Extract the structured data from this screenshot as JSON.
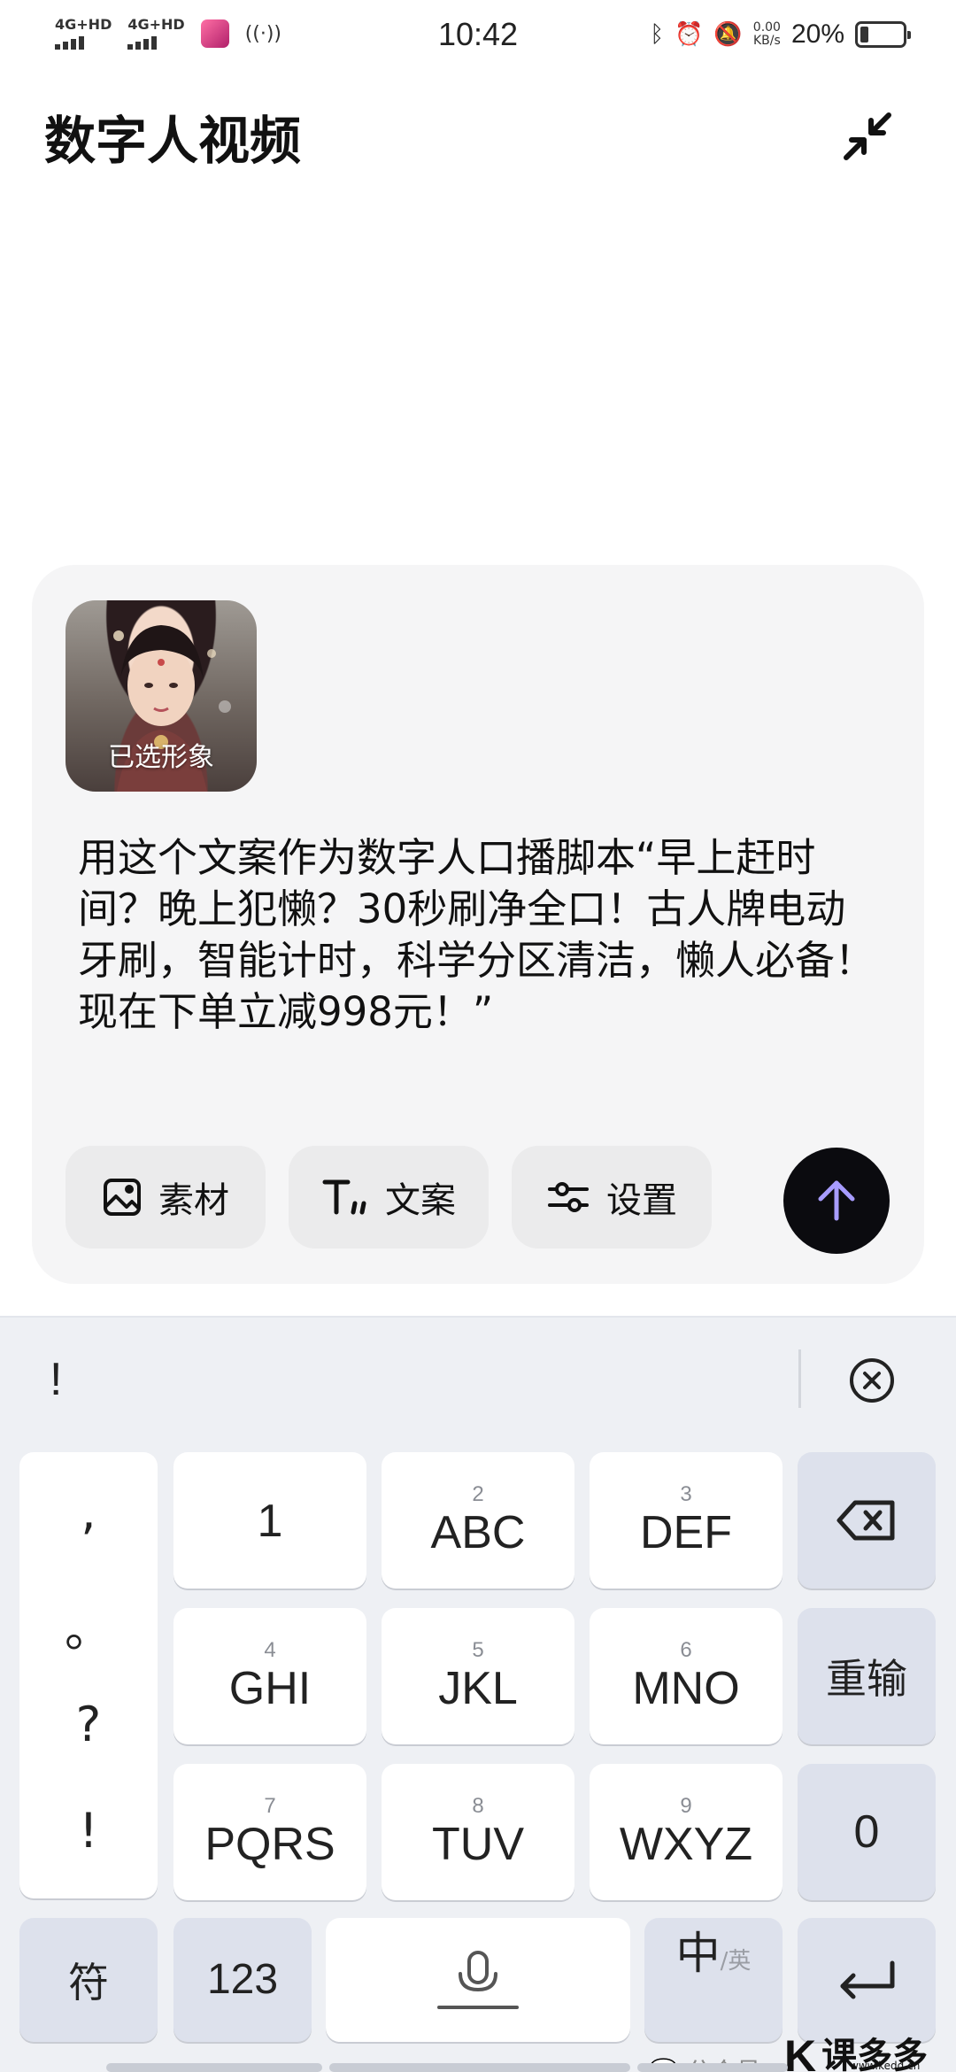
{
  "status_bar": {
    "signal_1": "4G+HD",
    "signal_2": "4G+HD",
    "time": "10:42",
    "net_speed_value": "0.00",
    "net_speed_unit": "KB/s",
    "battery_percent": "20%",
    "battery_level": 0.2
  },
  "header": {
    "title": "数字人视频"
  },
  "composer": {
    "avatar_label": "已选形象",
    "prompt": "用这个文案作为数字人口播脚本“早上赶时间？晚上犯懒？30秒刷净全口！古人牌电动牙刷，智能计时，科学分区清洁，懒人必备！现在下单立减998元！”",
    "chips": [
      {
        "label": "素材",
        "icon": "image-icon"
      },
      {
        "label": "文案",
        "icon": "text-format-icon"
      },
      {
        "label": "设置",
        "icon": "sliders-icon"
      }
    ],
    "send_icon": "arrow-up-icon",
    "send_icon_color": "#a79cff"
  },
  "keyboard": {
    "candidate": "!",
    "punctuation": [
      ",",
      "。",
      "?",
      "!"
    ],
    "rows": [
      [
        {
          "num": "",
          "label": "1"
        },
        {
          "num": "2",
          "label": "ABC"
        },
        {
          "num": "3",
          "label": "DEF"
        }
      ],
      [
        {
          "num": "4",
          "label": "GHI"
        },
        {
          "num": "5",
          "label": "JKL"
        },
        {
          "num": "6",
          "label": "MNO"
        }
      ],
      [
        {
          "num": "7",
          "label": "PQRS"
        },
        {
          "num": "8",
          "label": "TUV"
        },
        {
          "num": "9",
          "label": "WXYZ"
        }
      ]
    ],
    "reinput": "重输",
    "zero": "0",
    "symbols": "符",
    "numbers": "123",
    "lang_main": "中",
    "lang_alt": "/英"
  },
  "watermark": {
    "text": "公众号",
    "logo_k": "K",
    "logo_brand": "课多多",
    "logo_url": "www.kedd.cn"
  }
}
